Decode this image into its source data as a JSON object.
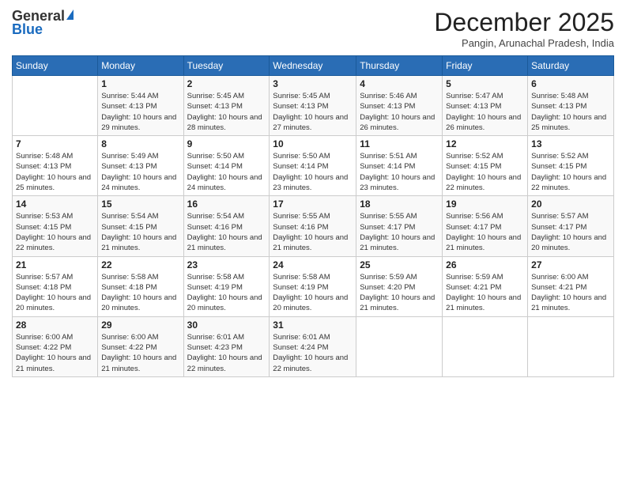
{
  "logo": {
    "general": "General",
    "blue": "Blue"
  },
  "header": {
    "month": "December 2025",
    "location": "Pangin, Arunachal Pradesh, India"
  },
  "weekdays": [
    "Sunday",
    "Monday",
    "Tuesday",
    "Wednesday",
    "Thursday",
    "Friday",
    "Saturday"
  ],
  "weeks": [
    [
      {
        "day": "",
        "sunrise": "",
        "sunset": "",
        "daylight": ""
      },
      {
        "day": "1",
        "sunrise": "Sunrise: 5:44 AM",
        "sunset": "Sunset: 4:13 PM",
        "daylight": "Daylight: 10 hours and 29 minutes."
      },
      {
        "day": "2",
        "sunrise": "Sunrise: 5:45 AM",
        "sunset": "Sunset: 4:13 PM",
        "daylight": "Daylight: 10 hours and 28 minutes."
      },
      {
        "day": "3",
        "sunrise": "Sunrise: 5:45 AM",
        "sunset": "Sunset: 4:13 PM",
        "daylight": "Daylight: 10 hours and 27 minutes."
      },
      {
        "day": "4",
        "sunrise": "Sunrise: 5:46 AM",
        "sunset": "Sunset: 4:13 PM",
        "daylight": "Daylight: 10 hours and 26 minutes."
      },
      {
        "day": "5",
        "sunrise": "Sunrise: 5:47 AM",
        "sunset": "Sunset: 4:13 PM",
        "daylight": "Daylight: 10 hours and 26 minutes."
      },
      {
        "day": "6",
        "sunrise": "Sunrise: 5:48 AM",
        "sunset": "Sunset: 4:13 PM",
        "daylight": "Daylight: 10 hours and 25 minutes."
      }
    ],
    [
      {
        "day": "7",
        "sunrise": "Sunrise: 5:48 AM",
        "sunset": "Sunset: 4:13 PM",
        "daylight": "Daylight: 10 hours and 25 minutes."
      },
      {
        "day": "8",
        "sunrise": "Sunrise: 5:49 AM",
        "sunset": "Sunset: 4:13 PM",
        "daylight": "Daylight: 10 hours and 24 minutes."
      },
      {
        "day": "9",
        "sunrise": "Sunrise: 5:50 AM",
        "sunset": "Sunset: 4:14 PM",
        "daylight": "Daylight: 10 hours and 24 minutes."
      },
      {
        "day": "10",
        "sunrise": "Sunrise: 5:50 AM",
        "sunset": "Sunset: 4:14 PM",
        "daylight": "Daylight: 10 hours and 23 minutes."
      },
      {
        "day": "11",
        "sunrise": "Sunrise: 5:51 AM",
        "sunset": "Sunset: 4:14 PM",
        "daylight": "Daylight: 10 hours and 23 minutes."
      },
      {
        "day": "12",
        "sunrise": "Sunrise: 5:52 AM",
        "sunset": "Sunset: 4:15 PM",
        "daylight": "Daylight: 10 hours and 22 minutes."
      },
      {
        "day": "13",
        "sunrise": "Sunrise: 5:52 AM",
        "sunset": "Sunset: 4:15 PM",
        "daylight": "Daylight: 10 hours and 22 minutes."
      }
    ],
    [
      {
        "day": "14",
        "sunrise": "Sunrise: 5:53 AM",
        "sunset": "Sunset: 4:15 PM",
        "daylight": "Daylight: 10 hours and 22 minutes."
      },
      {
        "day": "15",
        "sunrise": "Sunrise: 5:54 AM",
        "sunset": "Sunset: 4:15 PM",
        "daylight": "Daylight: 10 hours and 21 minutes."
      },
      {
        "day": "16",
        "sunrise": "Sunrise: 5:54 AM",
        "sunset": "Sunset: 4:16 PM",
        "daylight": "Daylight: 10 hours and 21 minutes."
      },
      {
        "day": "17",
        "sunrise": "Sunrise: 5:55 AM",
        "sunset": "Sunset: 4:16 PM",
        "daylight": "Daylight: 10 hours and 21 minutes."
      },
      {
        "day": "18",
        "sunrise": "Sunrise: 5:55 AM",
        "sunset": "Sunset: 4:17 PM",
        "daylight": "Daylight: 10 hours and 21 minutes."
      },
      {
        "day": "19",
        "sunrise": "Sunrise: 5:56 AM",
        "sunset": "Sunset: 4:17 PM",
        "daylight": "Daylight: 10 hours and 21 minutes."
      },
      {
        "day": "20",
        "sunrise": "Sunrise: 5:57 AM",
        "sunset": "Sunset: 4:17 PM",
        "daylight": "Daylight: 10 hours and 20 minutes."
      }
    ],
    [
      {
        "day": "21",
        "sunrise": "Sunrise: 5:57 AM",
        "sunset": "Sunset: 4:18 PM",
        "daylight": "Daylight: 10 hours and 20 minutes."
      },
      {
        "day": "22",
        "sunrise": "Sunrise: 5:58 AM",
        "sunset": "Sunset: 4:18 PM",
        "daylight": "Daylight: 10 hours and 20 minutes."
      },
      {
        "day": "23",
        "sunrise": "Sunrise: 5:58 AM",
        "sunset": "Sunset: 4:19 PM",
        "daylight": "Daylight: 10 hours and 20 minutes."
      },
      {
        "day": "24",
        "sunrise": "Sunrise: 5:58 AM",
        "sunset": "Sunset: 4:19 PM",
        "daylight": "Daylight: 10 hours and 20 minutes."
      },
      {
        "day": "25",
        "sunrise": "Sunrise: 5:59 AM",
        "sunset": "Sunset: 4:20 PM",
        "daylight": "Daylight: 10 hours and 21 minutes."
      },
      {
        "day": "26",
        "sunrise": "Sunrise: 5:59 AM",
        "sunset": "Sunset: 4:21 PM",
        "daylight": "Daylight: 10 hours and 21 minutes."
      },
      {
        "day": "27",
        "sunrise": "Sunrise: 6:00 AM",
        "sunset": "Sunset: 4:21 PM",
        "daylight": "Daylight: 10 hours and 21 minutes."
      }
    ],
    [
      {
        "day": "28",
        "sunrise": "Sunrise: 6:00 AM",
        "sunset": "Sunset: 4:22 PM",
        "daylight": "Daylight: 10 hours and 21 minutes."
      },
      {
        "day": "29",
        "sunrise": "Sunrise: 6:00 AM",
        "sunset": "Sunset: 4:22 PM",
        "daylight": "Daylight: 10 hours and 21 minutes."
      },
      {
        "day": "30",
        "sunrise": "Sunrise: 6:01 AM",
        "sunset": "Sunset: 4:23 PM",
        "daylight": "Daylight: 10 hours and 22 minutes."
      },
      {
        "day": "31",
        "sunrise": "Sunrise: 6:01 AM",
        "sunset": "Sunset: 4:24 PM",
        "daylight": "Daylight: 10 hours and 22 minutes."
      },
      {
        "day": "",
        "sunrise": "",
        "sunset": "",
        "daylight": ""
      },
      {
        "day": "",
        "sunrise": "",
        "sunset": "",
        "daylight": ""
      },
      {
        "day": "",
        "sunrise": "",
        "sunset": "",
        "daylight": ""
      }
    ]
  ]
}
